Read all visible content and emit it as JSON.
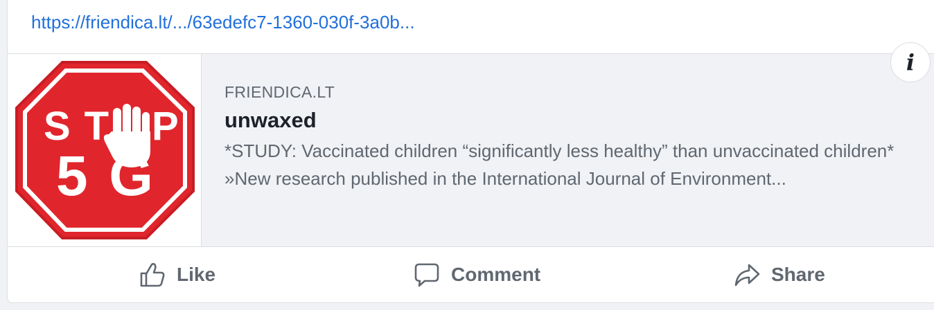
{
  "post": {
    "link_text": "https://friendica.lt/.../63edefc7-1360-030f-3a0b..."
  },
  "preview": {
    "thumbnail": {
      "sign_line1": "ST",
      "sign_line1_end": "P",
      "sign_line2": "5G",
      "colors": {
        "sign_red": "#e0262c",
        "sign_white": "#ffffff"
      }
    },
    "domain": "FRIENDICA.LT",
    "title": "unwaxed",
    "description": "*STUDY: Vaccinated children “significantly less healthy” than unvaccinated children* »New research published in the International Journal of Environment..."
  },
  "info_button": {
    "icon": "info-icon",
    "glyph": "i"
  },
  "actions": {
    "like": {
      "label": "Like",
      "icon": "thumbs-up-icon"
    },
    "comment": {
      "label": "Comment",
      "icon": "speech-bubble-icon"
    },
    "share": {
      "label": "Share",
      "icon": "share-arrow-icon"
    }
  },
  "colors": {
    "link": "#216fdb",
    "muted_text": "#606770",
    "title_text": "#1d2129",
    "preview_bg": "#f0f2f5"
  }
}
